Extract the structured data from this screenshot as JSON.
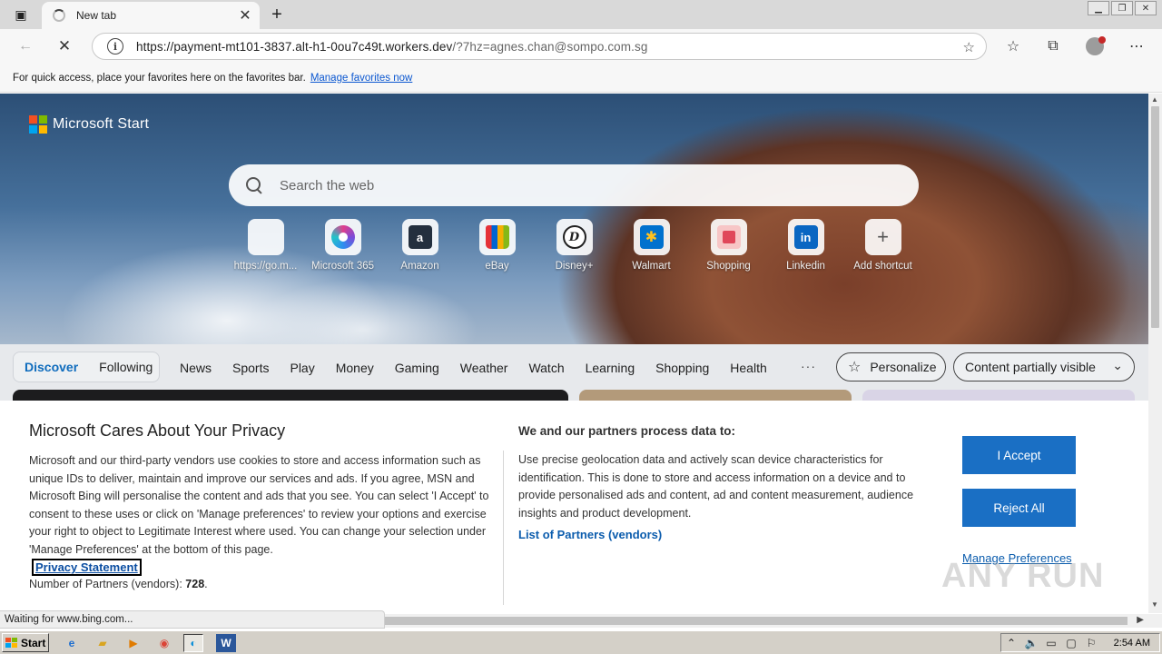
{
  "browser": {
    "tab_title": "New tab",
    "url_host": "https://payment-mt101-3837.alt-h1-0ou7c49t.workers.dev",
    "url_rest": "/?7hz=agnes.chan@sompo.com.sg",
    "favorites_prompt": "For quick access, place your favorites here on the favorites bar.",
    "favorites_link": "Manage favorites now",
    "status_text": "Waiting for www.bing.com..."
  },
  "page": {
    "brand": "Microsoft Start",
    "search_placeholder": "Search the web",
    "shortcuts": [
      {
        "label": "https://go.m...",
        "icon": "microsoft-icon"
      },
      {
        "label": "Microsoft 365",
        "icon": "m365-icon"
      },
      {
        "label": "Amazon",
        "icon": "amazon-icon",
        "glyph": "a"
      },
      {
        "label": "eBay",
        "icon": "ebay-icon"
      },
      {
        "label": "Disney+",
        "icon": "disney-icon",
        "glyph": "D"
      },
      {
        "label": "Walmart",
        "icon": "walmart-icon",
        "glyph": "✱"
      },
      {
        "label": "Shopping",
        "icon": "shopping-bag-icon"
      },
      {
        "label": "Linkedin",
        "icon": "linkedin-icon",
        "glyph": "in"
      },
      {
        "label": "Add shortcut",
        "icon": "plus-icon",
        "glyph": "+"
      }
    ],
    "feed_tabs": {
      "active": "Discover",
      "other": "Following"
    },
    "categories": [
      "News",
      "Sports",
      "Play",
      "Money",
      "Gaming",
      "Weather",
      "Watch",
      "Learning",
      "Shopping",
      "Health"
    ],
    "more": "···",
    "personalize": "Personalize",
    "content_visibility": "Content partially visible"
  },
  "privacy": {
    "title": "Microsoft Cares About Your Privacy",
    "body": "Microsoft and our third-party vendors use cookies to store and access information such as unique IDs to deliver, maintain and improve our services and ads. If you agree, MSN and Microsoft Bing will personalise the content and ads that you see. You can select 'I Accept' to consent to these uses or click on 'Manage preferences' to review your options and exercise your right to object to Legitimate Interest where used.  You can change your selection under 'Manage Preferences' at the bottom of this page.",
    "privacy_link": "Privacy Statement",
    "partners_label": "Number of Partners (vendors):",
    "partners_count": "728",
    "partners_suffix": ".",
    "process_heading": "We and our partners process data to:",
    "process_body": "Use precise geolocation data and actively scan device characteristics for identification. This is done to store and access information on a device and to provide personalised ads and content, ad and content measurement, audience insights and product development.",
    "vendors_link": "List of Partners (vendors)",
    "accept": "I Accept",
    "reject": "Reject All",
    "manage": "Manage Preferences"
  },
  "watermark": "ANY RUN",
  "taskbar": {
    "start": "Start",
    "time": "2:54 AM"
  },
  "colors": {
    "accent": "#1a6fc4",
    "link": "#0b5cad",
    "discover": "#0f6cbd"
  }
}
